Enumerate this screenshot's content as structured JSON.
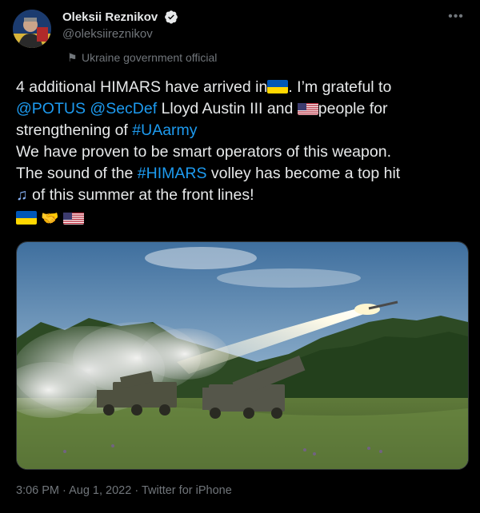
{
  "author": {
    "display_name": "Oleksii Reznikov",
    "handle": "@oleksiireznikov",
    "affiliation": "Ukraine government official",
    "verified": true
  },
  "tweet": {
    "line1_a": "4 additional HIMARS have arrived in",
    "line1_b": ". I’m grateful to",
    "mention1": "@POTUS",
    "mention2": "@SecDef",
    "line2_a": " Lloyd Austin III and ",
    "line2_b": "people for",
    "line3_a": "strengthening of ",
    "hashtag1": "#UAarmy",
    "line4": "We have proven to be smart operators of this weapon.",
    "line5_a": "The sound of the ",
    "hashtag2": "#HIMARS",
    "line5_b": " volley has become a top hit",
    "line6": " of this summer at the front lines!",
    "emoji_row": [
      "ukraine-flag",
      "handshake",
      "us-flag"
    ]
  },
  "meta": {
    "time": "3:06 PM",
    "date": "Aug 1, 2022",
    "source": "Twitter for iPhone",
    "separator": " · "
  },
  "colors": {
    "background": "#000000",
    "text": "#e7e9ea",
    "muted": "#71767b",
    "link": "#1d9bf0",
    "verified": "#1d9bf0"
  }
}
